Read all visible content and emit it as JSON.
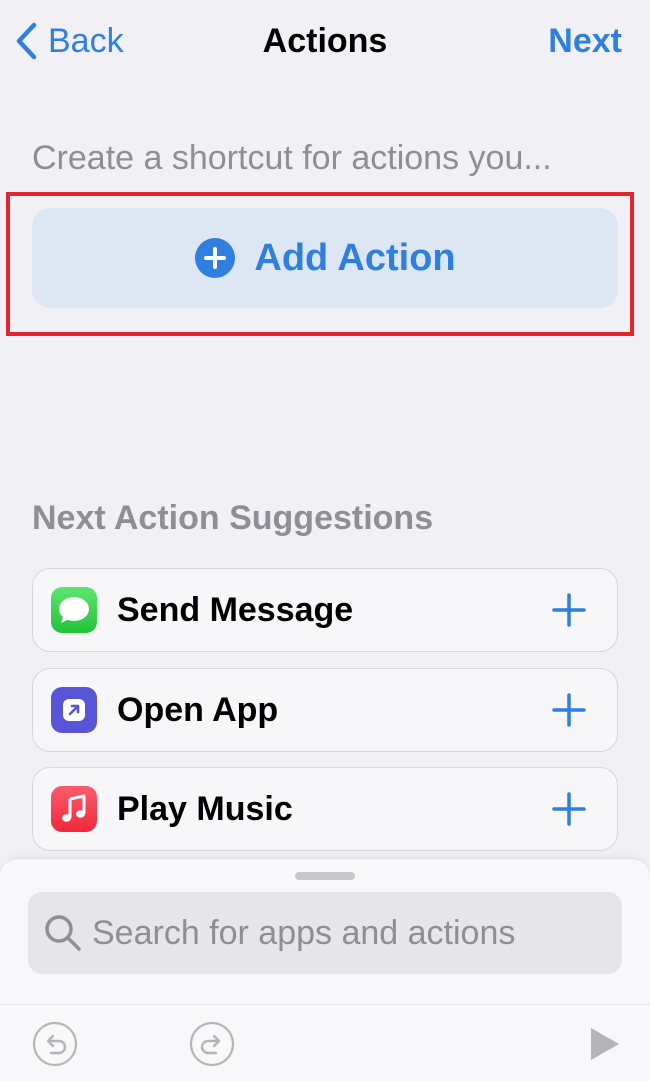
{
  "nav": {
    "back_label": "Back",
    "title": "Actions",
    "next_label": "Next"
  },
  "subtitle": "Create a shortcut for actions you...",
  "add_action": {
    "label": "Add Action"
  },
  "suggestions": {
    "header": "Next Action Suggestions",
    "items": [
      {
        "label": "Send Message",
        "icon": "messages-icon",
        "color": "#34c759"
      },
      {
        "label": "Open App",
        "icon": "open-app-icon",
        "color": "#5856d6"
      },
      {
        "label": "Play Music",
        "icon": "music-icon",
        "color": "#fa3c4c"
      }
    ]
  },
  "search": {
    "placeholder": "Search for apps and actions"
  },
  "colors": {
    "accent": "#2f7fe0",
    "highlight": "#e4242b"
  }
}
